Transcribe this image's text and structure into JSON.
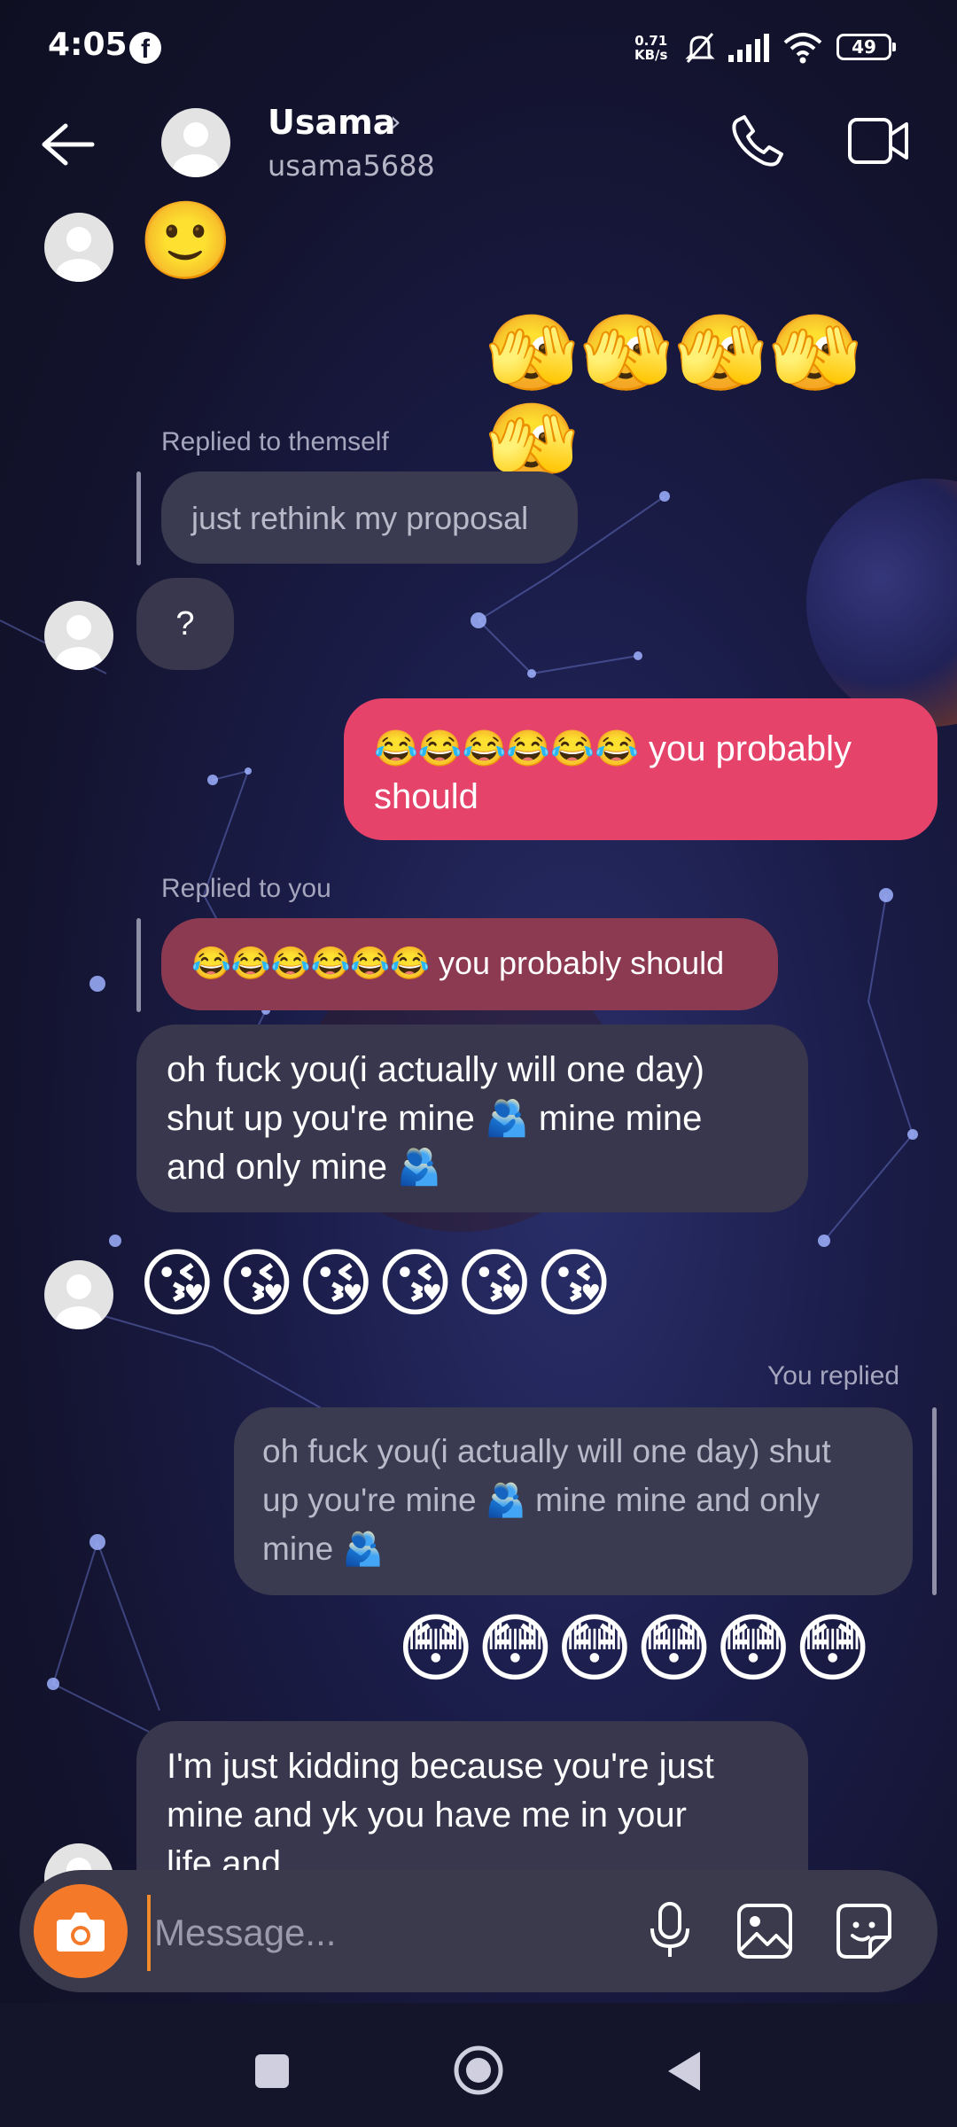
{
  "status_bar": {
    "time": "4:05",
    "app_icon": "facebook-icon",
    "net_speed_value": "0.71",
    "net_speed_unit": "KB/s",
    "battery": "49",
    "icons": [
      "mute-icon",
      "signal-icon",
      "wifi-icon",
      "battery-icon"
    ]
  },
  "header": {
    "back_icon": "back-arrow-icon",
    "name": "Usama",
    "chevron": "›",
    "username": "usama5688",
    "call_icon": "phone-icon",
    "video_icon": "video-icon"
  },
  "messages": {
    "m1": {
      "from": "them",
      "text": "🙂"
    },
    "m2": {
      "from": "me",
      "text": "🫣🫣🫣🫣🫣"
    },
    "m3_note": "Replied to themself",
    "m3_quote": "just rethink my proposal",
    "m3": {
      "from": "them",
      "text": "?"
    },
    "m4": {
      "from": "me",
      "line1": "😂😂😂😂😂😂 you probably",
      "line2": "should"
    },
    "m5_note": "Replied to you",
    "m5_quote": "😂😂😂😂😂😂 you probably should",
    "m5": {
      "from": "them",
      "line1": "oh fuck you(i actually will one day)",
      "line2": "shut up you're mine 🫂 mine mine",
      "line3": "and only mine 🫂"
    },
    "m6": {
      "from": "them",
      "text": "😘😘😘😘😘😘"
    },
    "m7_note": "You replied",
    "m7_quote_line1": "oh fuck you(i actually will one day)  shut",
    "m7_quote_line2": "up you're mine 🫂 mine mine and only",
    "m7_quote_line3": "mine 🫂",
    "m7": {
      "from": "me",
      "text": "😳😳😳😳😳😳"
    },
    "m8": {
      "from": "them",
      "line1": "I'm just kidding because you're just",
      "line2": "mine and yk you have me in your",
      "line3": "life and"
    }
  },
  "composer": {
    "camera_icon": "camera-icon",
    "placeholder": "Message...",
    "mic_icon": "microphone-icon",
    "gallery_icon": "gallery-icon",
    "sticker_icon": "sticker-icon"
  },
  "nav": {
    "recents": "recents-square-icon",
    "home": "home-circle-icon",
    "back": "back-triangle-icon"
  },
  "colors": {
    "my_bubble": "#e6436b",
    "their_bubble": "#39374d",
    "camera_button": "#f47a2a"
  }
}
